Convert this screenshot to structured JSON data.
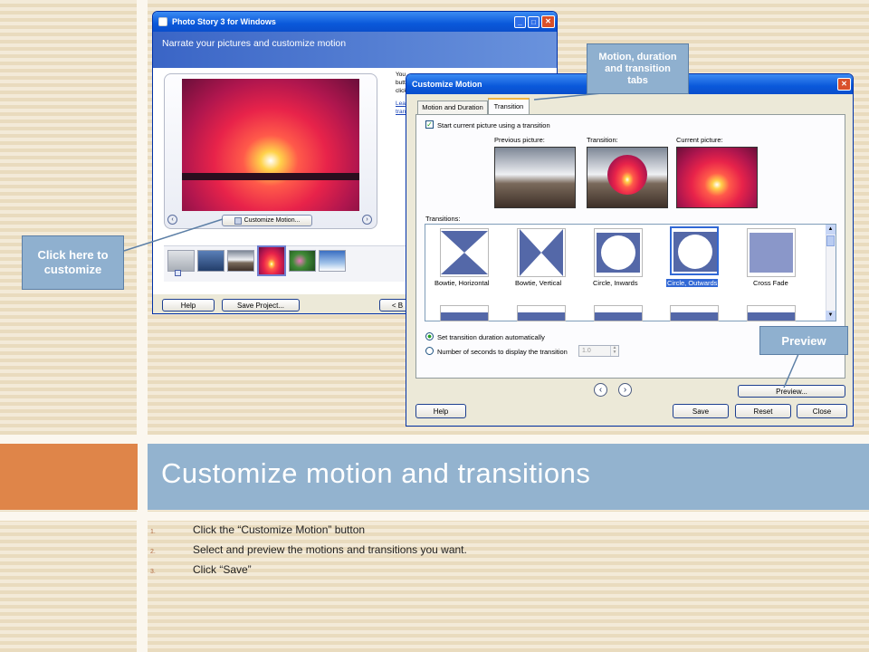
{
  "slide": {
    "title": "Customize motion and transitions",
    "steps": [
      {
        "num": "1.",
        "text": "Click the “Customize Motion” button"
      },
      {
        "num": "2.",
        "text": "Select and preview the motions and transitions you want."
      },
      {
        "num": "3.",
        "text": "Click “Save”"
      }
    ]
  },
  "callouts": {
    "click_here": "Click here to customize",
    "tabs": "Motion, duration and transition tabs",
    "preview": "Preview"
  },
  "photostory": {
    "title": "Photo Story 3 for Windows",
    "header": "Narrate your pictures and customize motion",
    "customize_button": "Customize Motion...",
    "side_text": [
      "You",
      "butt",
      "click"
    ],
    "side_link": [
      "Lea",
      "tran"
    ],
    "help_button": "Help",
    "save_project_button": "Save Project...",
    "back_button": "< B"
  },
  "dialog": {
    "title": "Customize Motion",
    "tabs": [
      "Motion and Duration",
      "Transition"
    ],
    "start_checkbox": "Start current picture using a transition",
    "previous_label": "Previous picture:",
    "transition_label": "Transition:",
    "current_label": "Current picture:",
    "transitions_label": "Transitions:",
    "transitions": [
      {
        "name": "Bowtie, Horizontal",
        "selected": false
      },
      {
        "name": "Bowtie, Vertical",
        "selected": false
      },
      {
        "name": "Circle, Inwards",
        "selected": false
      },
      {
        "name": "Circle, Outwards",
        "selected": true
      },
      {
        "name": "Cross Fade",
        "selected": false
      }
    ],
    "radio_auto": "Set transition duration automatically",
    "radio_seconds": "Number of seconds to display the transition",
    "seconds_value": "1.0",
    "preview_button": "Preview...",
    "help_button": "Help",
    "save_button": "Save",
    "reset_button": "Reset",
    "close_button": "Close"
  },
  "colors": {
    "title_band": "#93b3cf",
    "accent_orange": "#df8549",
    "xp_blue": "#0a58da"
  }
}
